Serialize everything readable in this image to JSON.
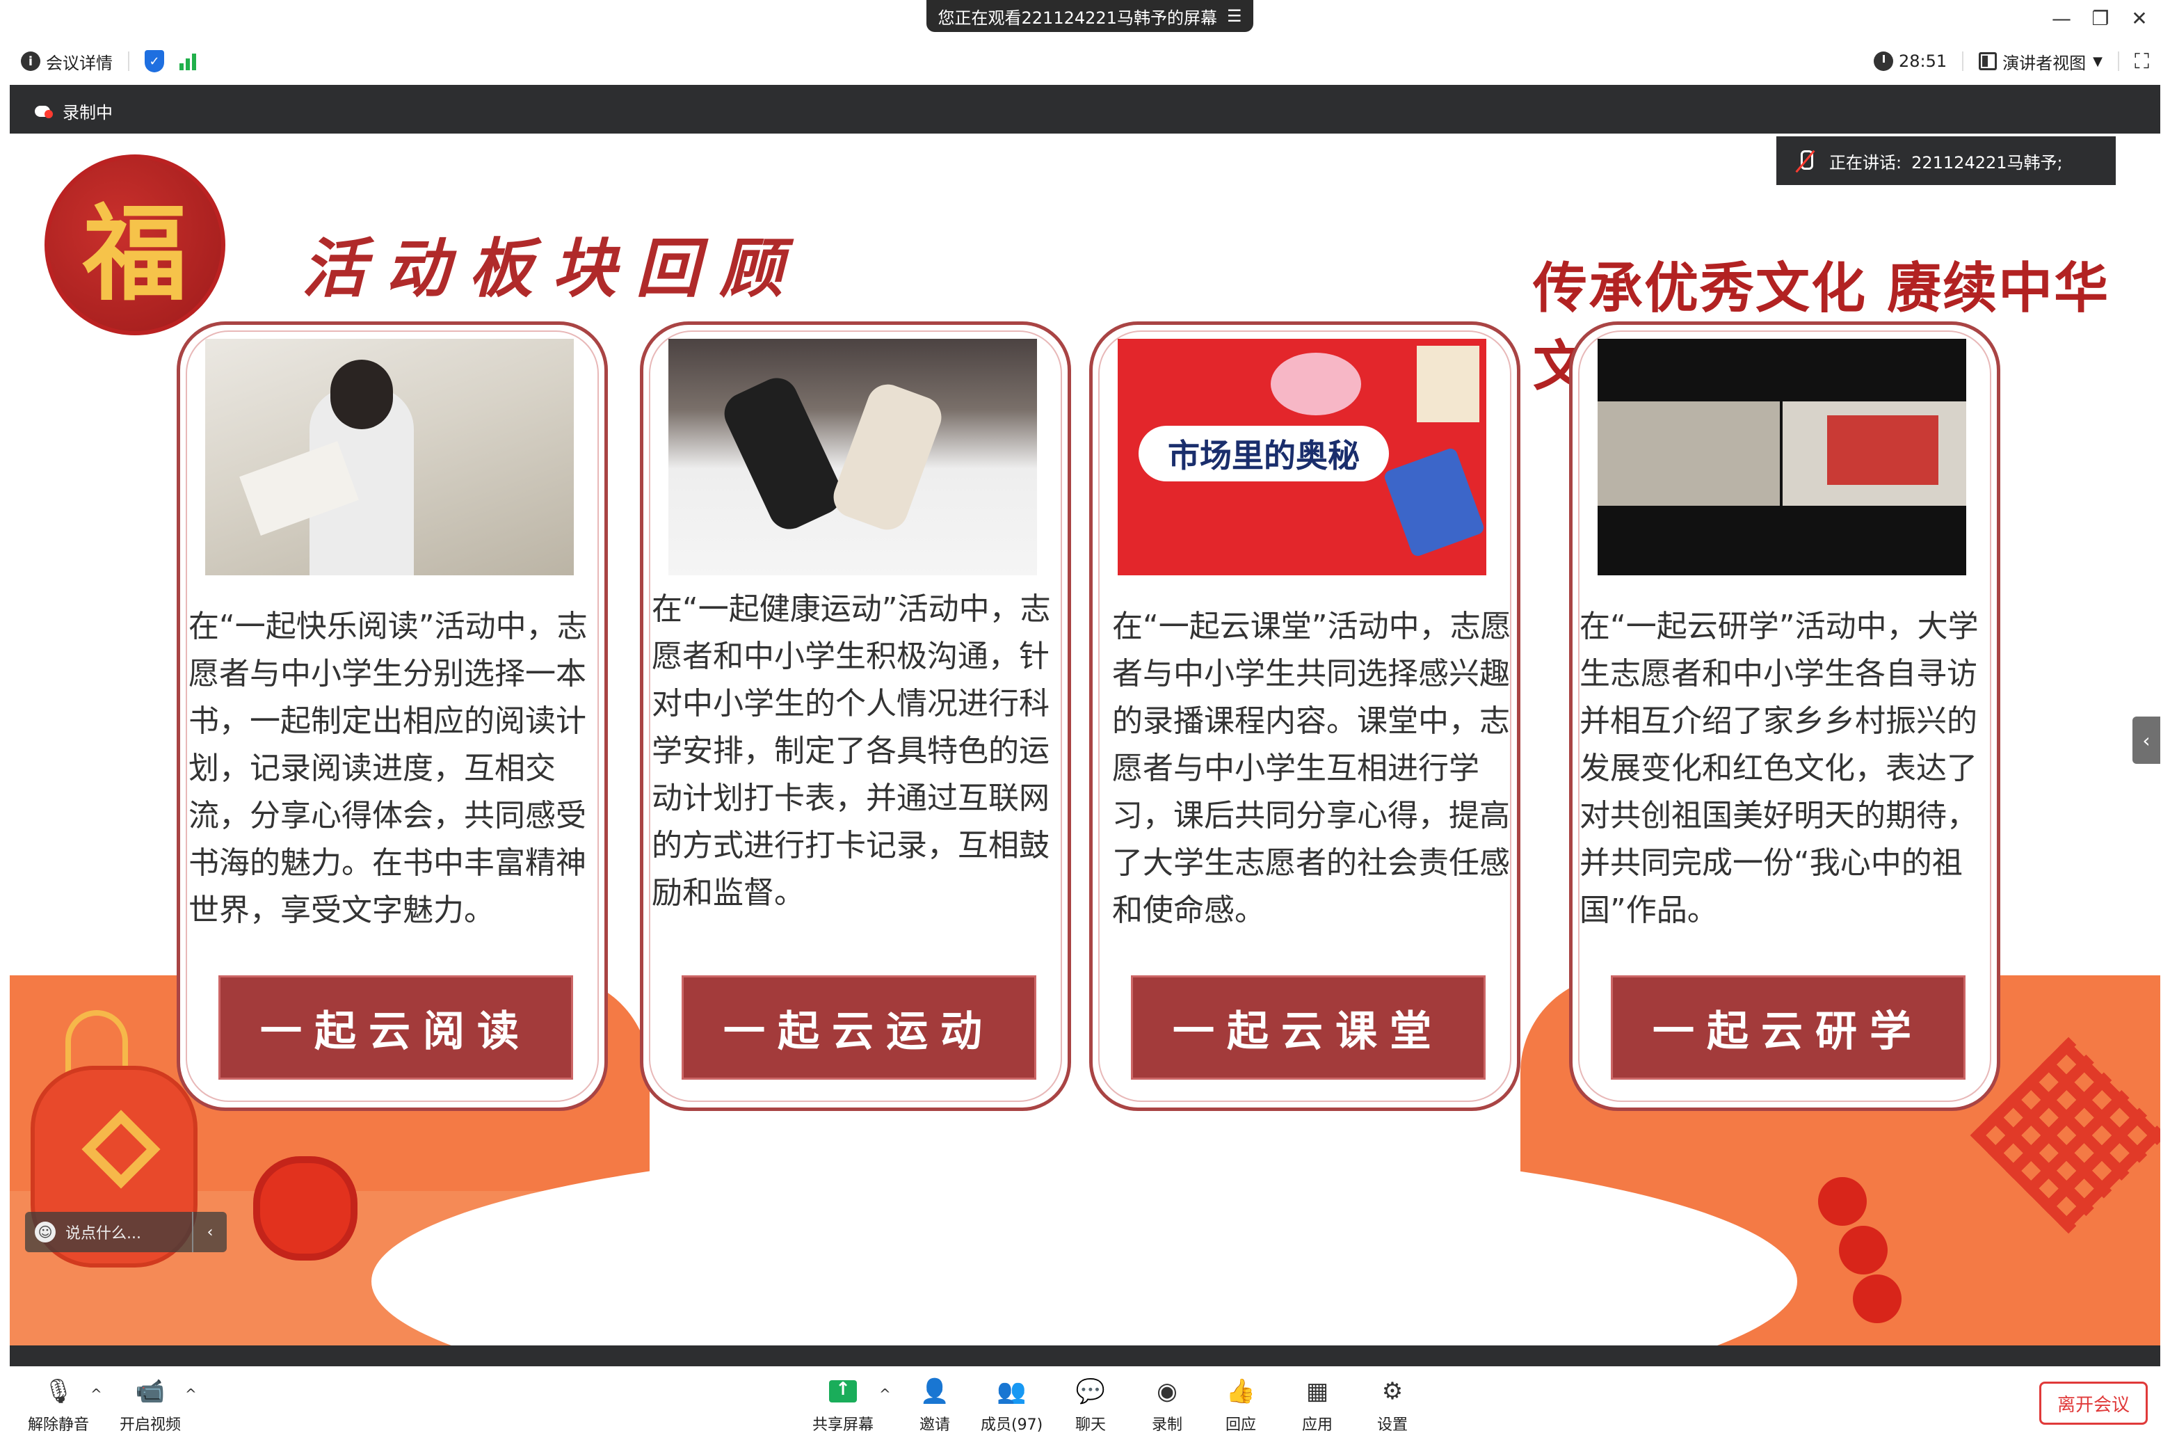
{
  "window": {
    "viewing_banner": "您正在观看221124221马韩予的屏幕",
    "viewing_menu_icon": "list-icon",
    "controls": {
      "minimize": "—",
      "restore": "❐",
      "close": "✕"
    }
  },
  "topbar": {
    "meeting_info": "会议详情",
    "security_icon": "shield-check-icon",
    "signal_icon": "signal-bars-icon",
    "timer": "28:51",
    "view_mode": "演讲者视图",
    "fullscreen_icon": "fullscreen-icon"
  },
  "share": {
    "recording_label": "录制中",
    "speaking_label": "正在讲话:",
    "speaking_name": "221124221马韩予;",
    "side_toggle": "‹"
  },
  "slide": {
    "badge_char": "福",
    "title_left": "活动板块回顾",
    "title_right": "传承优秀文化 赓续中华文脉",
    "cards": [
      {
        "text": "在“一起快乐阅读”活动中，志愿者与中小学生分别选择一本书，一起制定出相应的阅读计划，记录阅读进度，互相交流，分享心得体会，共同感受书海的魅力。在书中丰富精神世界，享受文字魅力。",
        "button": "一起云阅读"
      },
      {
        "text": "在“一起健康运动”活动中，志愿者和中小学生积极沟通，针对中小学生的个人情况进行科学安排，制定了各具特色的运动计划打卡表，并通过互联网的方式进行打卡记录，互相鼓励和监督。",
        "button": "一起云运动"
      },
      {
        "text": "在“一起云课堂”活动中，志愿者与中小学生共同选择感兴趣的录播课程内容。课堂中，志愿者与中小学生互相进行学习，课后共同分享心得，提高了大学生志愿者的社会责任感和使命感。",
        "button": "一起云课堂",
        "photo_caption": "市场里的奥秘"
      },
      {
        "text": "在“一起云研学”活动中，大学生志愿者和中小学生各自寻访并相互介绍了家乡乡村振兴的发展变化和红色文化，表达了对共创祖国美好明天的期待，并共同完成一份“我心中的祖国”作品。",
        "button": "一起云研学"
      }
    ]
  },
  "chat": {
    "placeholder": "说点什么...",
    "collapse": "‹"
  },
  "toolbar": {
    "unmute": "解除静音",
    "start_video": "开启视频",
    "share_screen": "共享屏幕",
    "invite": "邀请",
    "members": "成员(97)",
    "chat": "聊天",
    "record": "录制",
    "reactions": "回应",
    "apps": "应用",
    "settings": "设置",
    "leave": "离开会议"
  }
}
